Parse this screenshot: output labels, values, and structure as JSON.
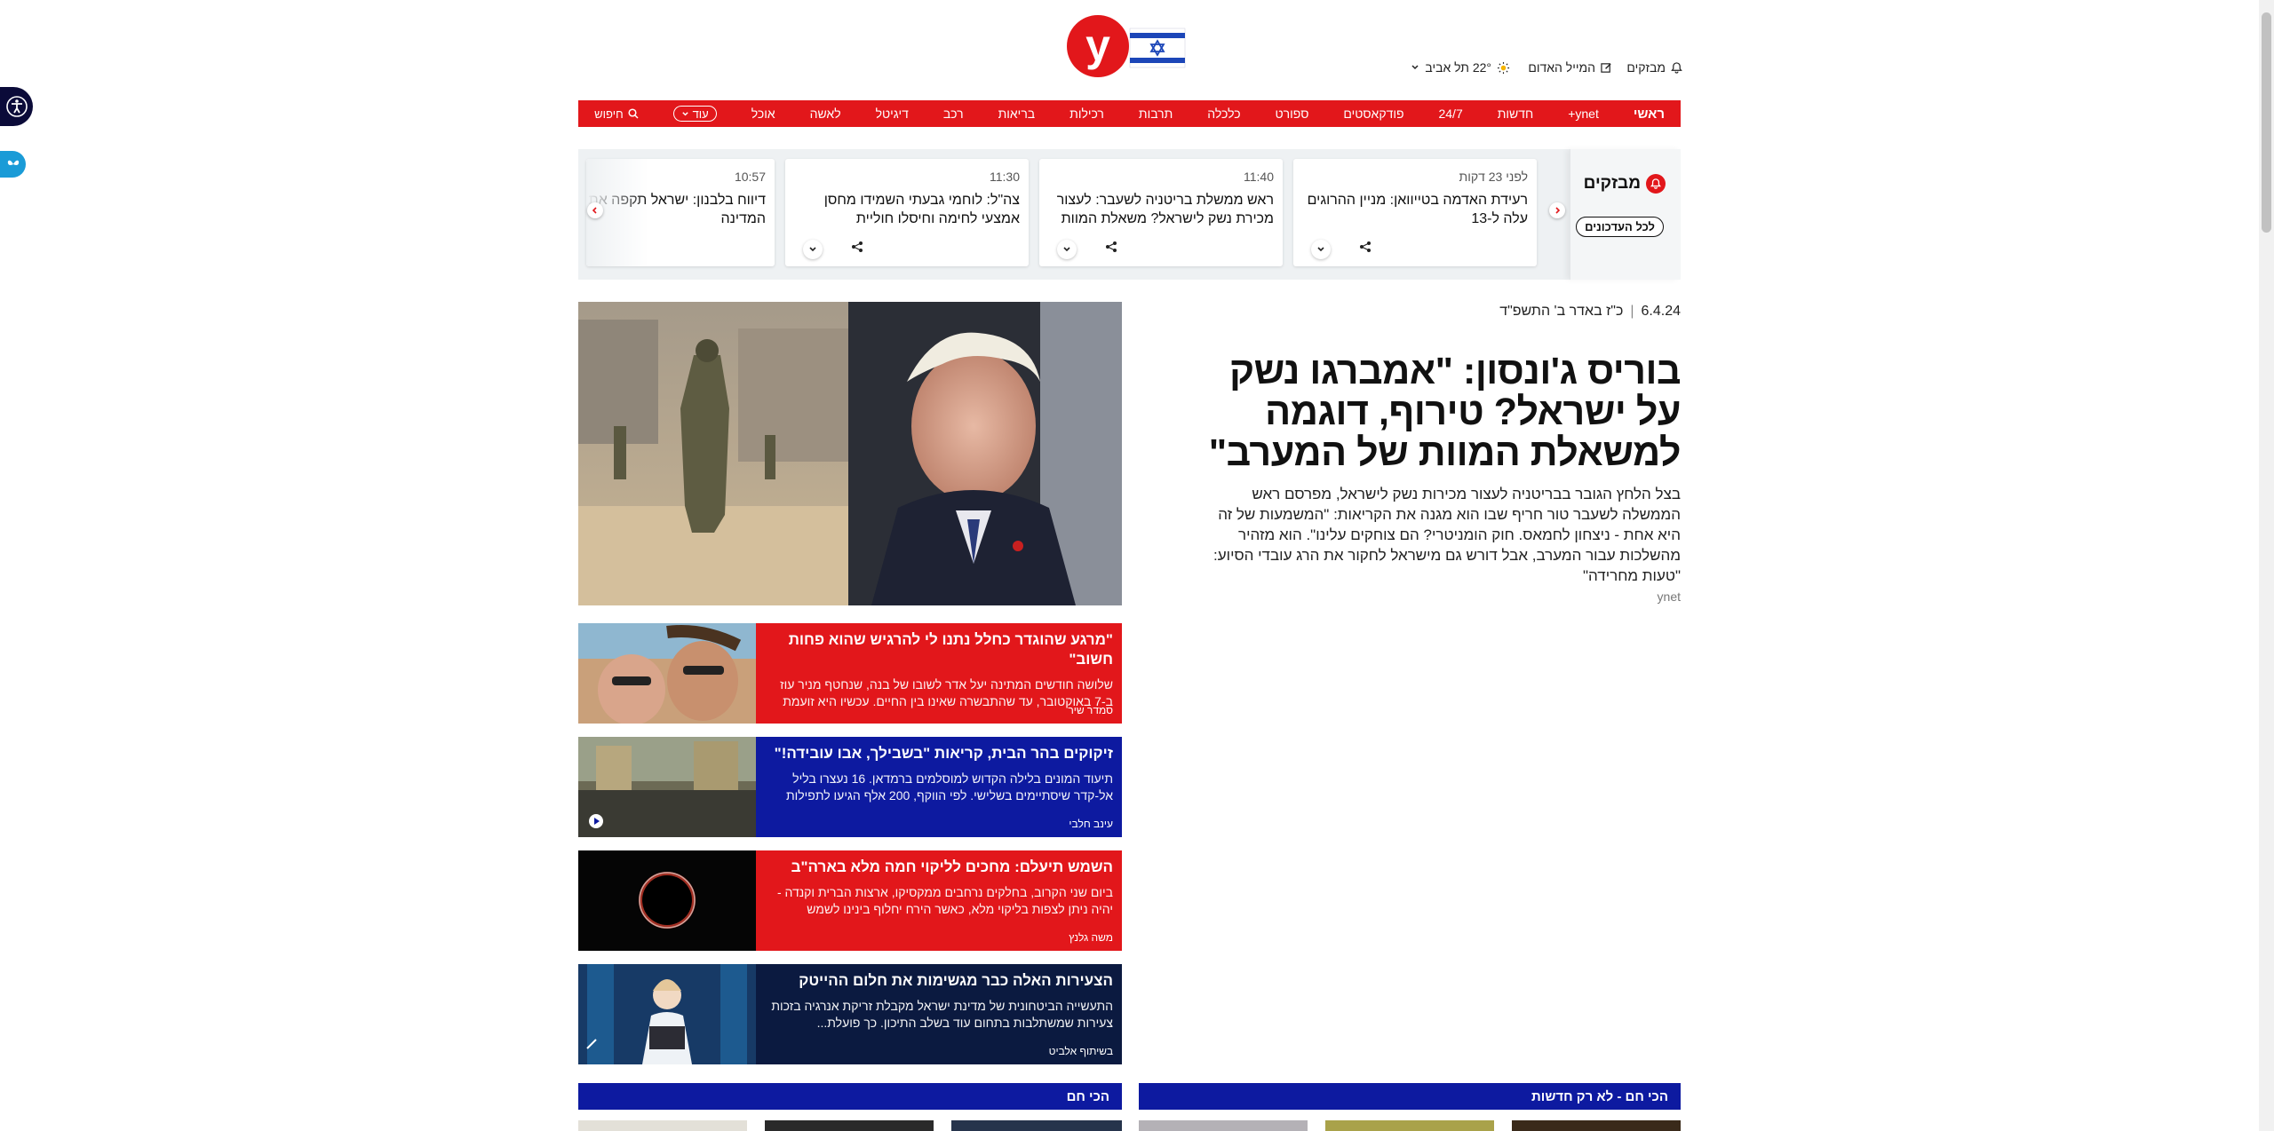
{
  "header": {
    "trending_label": "מבזקים",
    "newsletter_label": "המייל האדום",
    "weather_label": "22° תל אביב"
  },
  "nav": {
    "items": [
      "ראשי",
      "ynet+",
      "חדשות",
      "24/7",
      "פודקאסטים",
      "ספורט",
      "כלכלה",
      "תרבות",
      "רכילות",
      "בריאות",
      "רכב",
      "דיגיטל",
      "לאשה",
      "אוכל"
    ],
    "more_label": "עוד",
    "search_label": "חיפוש"
  },
  "ticker": {
    "title": "מבזקים",
    "all_button": "לכל העדכונים",
    "cards": [
      {
        "time": "לפני 23 דקות",
        "text": "רעידת האדמה בטייוואן: מניין ההרוגים עלה ל-13"
      },
      {
        "time": "11:40",
        "text": "ראש ממשלת בריטניה לשעבר: לעצור מכירת נשק לישראל? משאלת המוות ש..."
      },
      {
        "time": "11:30",
        "text": "צה\"ל: לוחמי גבעתי השמידו מחסן אמצעי לחימה וחיסלו חוליית מחבלים..."
      },
      {
        "time": "10:57",
        "text": "דיווח בלבנון: ישראל תקפה את דרום המדינה"
      }
    ]
  },
  "main": {
    "date": "6.4.24",
    "hebrew_date": "כ\"ז באדר ב' התשפ\"ד",
    "headline": "בוריס ג'ונסון: \"אמברגו נשק על ישראל? טירוף, דוגמה למשאלת המוות של המערב\"",
    "summary": "בצל הלחץ הגובר בבריטניה לעצור מכירות נשק לישראל, מפרסם ראש הממשלה לשעבר טור חריף שבו הוא מגנה את הקריאות: \"המשמעות של זה היא אחת - ניצחון לחמאס. חוק הומניטרי? הם צוחקים עלינו\". הוא מזהיר מהשלכות עבור המערב, אבל דורש גם מישראל לחקור את הרג עובדי הסיוע: \"טעות מחרידה\"",
    "credit": "ynet"
  },
  "stories": [
    {
      "color": "#e2171b",
      "title": "\"מרגע שהוגדר כחלל נתנו לי להרגיש שהוא פחות חשוב\"",
      "sub": "שלושה חודשים המתינה יעל אדר לשובו של בנה, שנחטף מניר עוז ב-7 באוקטובר, עד שהתבשרה שאינו בין החיים. עכשיו היא זועמת",
      "author": "סמדר שיר"
    },
    {
      "color": "#0d1aa0",
      "title": "זיקוקים בהר הבית, קריאות \"בשבילך, אבו עובידה!\"",
      "sub": "תיעוד המונים בלילה הקדוש למוסלמים ברמדאן. 16 נעצרו בליל אל-קדר שיסתיימים בשלישי. לפי הווקף, 200 אלף הגיעו לתפילות",
      "author": "עינב חלבי"
    },
    {
      "color": "#e2171b",
      "title": "השמש תיעלם: מחכים לליקוי חמה מלא בארה\"ב",
      "sub": "ביום שני הקרוב, בחלקים נרחבים ממקסיקו, ארצות הברית וקנדה - יהיה ניתן לצפות בליקוי מלא, כאשר הירח יחלוף בינינו לשמש",
      "author": "משה גלנץ"
    },
    {
      "color": "#0b1a40",
      "title": "הצעירות האלה כבר מגשימות את חלום ההייטק",
      "sub": "התעשייה הביטחונית של מדינת ישראל מקבלת זריקת אנרגיה בזכות צעירות שמשתלבות בתחום עוד בשלב התיכון. כך פועלת...",
      "author": "בשיתוף אלביט"
    }
  ],
  "bottom": {
    "right_bar": "הכי חם - לא רק חדשות",
    "left_bar": "הכי חם"
  },
  "colors": {
    "brand_red": "#e2171b",
    "brand_blue": "#0d1aa0"
  }
}
